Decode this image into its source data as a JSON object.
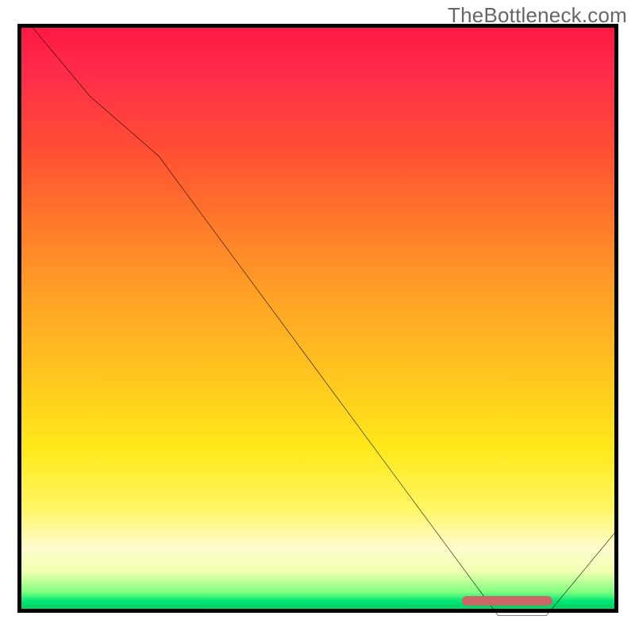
{
  "watermark": "TheBottleneck.com",
  "colors": {
    "frame": "#000000",
    "curve": "#000000",
    "marker": "#cc6666",
    "watermark": "#666666"
  },
  "chart_data": {
    "type": "line",
    "title": "",
    "xlabel": "",
    "ylabel": "",
    "xlim": [
      0,
      100
    ],
    "ylim": [
      0,
      100
    ],
    "series": [
      {
        "name": "bottleneck-curve",
        "x": [
          2,
          12,
          23.5,
          80,
          88,
          100
        ],
        "y": [
          100,
          88,
          78,
          1.5,
          1.5,
          16
        ]
      }
    ],
    "marker": {
      "x_start": 74,
      "x_end": 89,
      "y": 2,
      "label": ""
    },
    "gradient_stops": [
      {
        "pos": 0,
        "color": "#ff1744"
      },
      {
        "pos": 0.22,
        "color": "#ff5033"
      },
      {
        "pos": 0.46,
        "color": "#ffa126"
      },
      {
        "pos": 0.72,
        "color": "#ffe81a"
      },
      {
        "pos": 0.93,
        "color": "#f0ffb0"
      },
      {
        "pos": 1.0,
        "color": "#00c853"
      }
    ]
  }
}
